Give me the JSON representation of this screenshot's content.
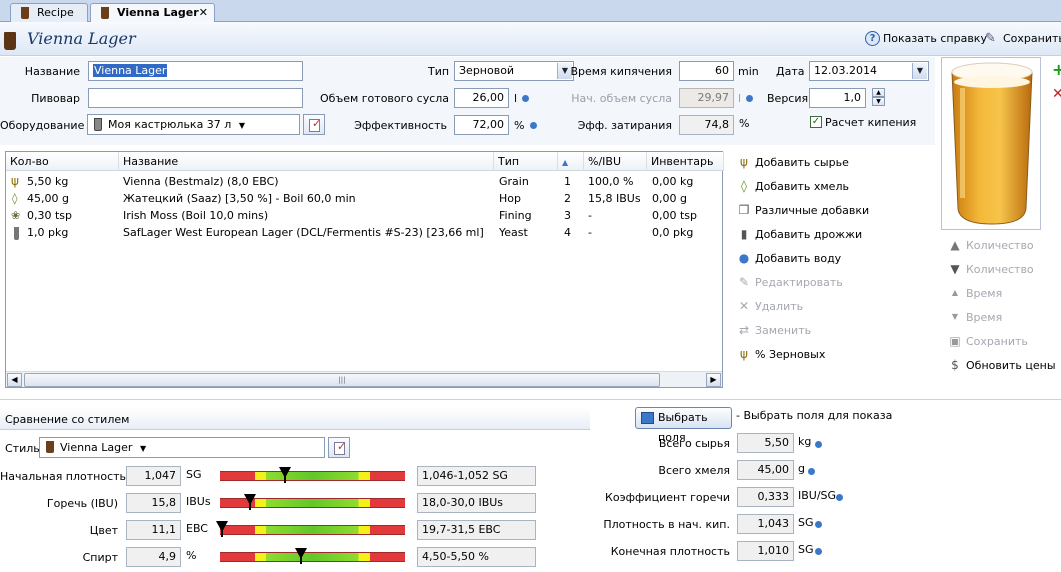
{
  "tabs": [
    {
      "label": "Recipe",
      "active": false
    },
    {
      "label": "Vienna Lager",
      "active": true,
      "close": "✕"
    }
  ],
  "header": {
    "title": "Vienna Lager",
    "help_label": "Показать справку",
    "save_label": "Сохранить"
  },
  "form": {
    "name_label": "Название",
    "name_value": "Vienna Lager",
    "brewer_label": "Пивовар",
    "brewer_value": "",
    "equipment_label": "Оборудование",
    "equipment_value": "Моя кастрюлька 37 л",
    "type_label": "Тип",
    "type_value": "Зерновой",
    "batch_label": "Объем готового сусла",
    "batch_value": "26,00",
    "batch_unit": "l",
    "efficiency_label": "Эффективность",
    "efficiency_value": "72,00",
    "efficiency_unit": "%",
    "boil_time_label": "Время кипячения",
    "boil_time_value": "60",
    "boil_time_unit": "min",
    "boil_size_label": "Нач. объем сусла",
    "boil_size_value": "29,97",
    "boil_size_unit": "l",
    "mash_eff_label": "Эфф. затирания",
    "mash_eff_value": "74,8",
    "mash_eff_unit": "%",
    "date_label": "Дата",
    "date_value": "12.03.2014",
    "version_label": "Версия",
    "version_value": "1,0",
    "calc_boil_label": "Расчет кипения",
    "calc_boil_checked": true
  },
  "ingredients": {
    "columns": [
      "Кол-во",
      "Название",
      "Тип",
      "",
      "%/IBU",
      "Инвентарь"
    ],
    "rows": [
      {
        "amount": "5,50 kg",
        "name": "Vienna (Bestmalz) (8,0 EBC)",
        "type": "Grain",
        "order": "1",
        "pct": "100,0 %",
        "inventory": "0,00 kg",
        "icon": "grain-icon"
      },
      {
        "amount": "45,00 g",
        "name": "Жатецкий (Saaz) [3,50 %] - Boil 60,0 min",
        "type": "Hop",
        "order": "2",
        "pct": "15,8 IBUs",
        "inventory": "0,00 g",
        "icon": "hop-icon"
      },
      {
        "amount": "0,30 tsp",
        "name": "Irish Moss (Boil 10,0 mins)",
        "type": "Fining",
        "order": "3",
        "pct": "-",
        "inventory": "0,00 tsp",
        "icon": "misc-icon"
      },
      {
        "amount": "1,0 pkg",
        "name": "SafLager West European Lager (DCL/Fermentis #S-23) [23,66 ml]",
        "type": "Yeast",
        "order": "4",
        "pct": "-",
        "inventory": "0,0 pkg",
        "icon": "yeast-icon"
      }
    ]
  },
  "actions": {
    "add_grain": "Добавить сырье",
    "add_hop": "Добавить хмель",
    "add_misc": "Различные добавки",
    "add_yeast": "Добавить дрожжи",
    "add_water": "Добавить воду",
    "edit": "Редактировать",
    "delete": "Удалить",
    "replace": "Заменить",
    "grain_pct": "% Зерновых"
  },
  "side_actions": {
    "qty_up": "Количество",
    "qty_down": "Количество",
    "time_up": "Время",
    "time_down": "Время",
    "save": "Сохранить",
    "update_prices": "Обновить цены"
  },
  "style_compare": {
    "section_title": "Сравнение со стилем",
    "style_label": "Стиль",
    "style_value": "Vienna Lager",
    "rows": [
      {
        "label": "Начальная плотность",
        "value": "1,047",
        "unit": "SG",
        "range": "1,046-1,052 SG",
        "marker_pct": 35
      },
      {
        "label": "Горечь (IBU)",
        "value": "15,8",
        "unit": "IBUs",
        "range": "18,0-30,0 IBUs",
        "marker_pct": 16
      },
      {
        "label": "Цвет",
        "value": "11,1",
        "unit": "EBC",
        "range": "19,7-31,5 EBC",
        "marker_pct": 1
      },
      {
        "label": "Спирт",
        "value": "4,9",
        "unit": "%",
        "range": "4,50-5,50 %",
        "marker_pct": 44
      }
    ]
  },
  "stats": {
    "choose_fields_button": "Выбрать поля",
    "choose_fields_hint": "- Выбрать поля для показа",
    "rows": [
      {
        "label": "Всего сырья",
        "value": "5,50",
        "unit": "kg"
      },
      {
        "label": "Всего хмеля",
        "value": "45,00",
        "unit": "g"
      },
      {
        "label": "Коэффициент горечи",
        "value": "0,333",
        "unit": "IBU/SG"
      },
      {
        "label": "Плотность в нач. кип.",
        "value": "1,043",
        "unit": "SG"
      },
      {
        "label": "Конечная плотность",
        "value": "1,010",
        "unit": "SG"
      }
    ]
  },
  "colors": {
    "accent": "#316ac5",
    "title": "#1b3766",
    "beer": "#e9a62a"
  }
}
